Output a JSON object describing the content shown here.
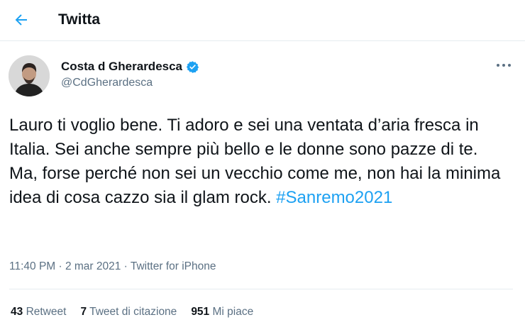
{
  "header": {
    "title": "Twitta"
  },
  "tweet": {
    "author": {
      "name": "Costa d Gherardesca",
      "handle": "@CdGherardesca",
      "verified": true
    },
    "text": "Lauro ti voglio bene. Ti adoro e sei una ventata d’aria fresca in Italia. Sei anche sempre più bello e le donne sono pazze di te. Ma, forse perché non sei un vecchio come me, non hai la minima idea di cosa cazzo sia il glam rock.",
    "hashtag": "#Sanremo2021",
    "meta": "11:40 PM · 2 mar 2021 · Twitter for iPhone"
  },
  "stats": [
    {
      "count": "43",
      "label": "Retweet"
    },
    {
      "count": "7",
      "label": "Tweet di citazione"
    },
    {
      "count": "951",
      "label": "Mi piace"
    }
  ],
  "colors": {
    "accent": "#1da1f2",
    "secondary_text": "#5b7083",
    "divider": "#e6ecf0"
  },
  "icons": {
    "back": "arrow-left-icon",
    "verified": "verified-badge-icon",
    "more": "more-dots-icon"
  }
}
